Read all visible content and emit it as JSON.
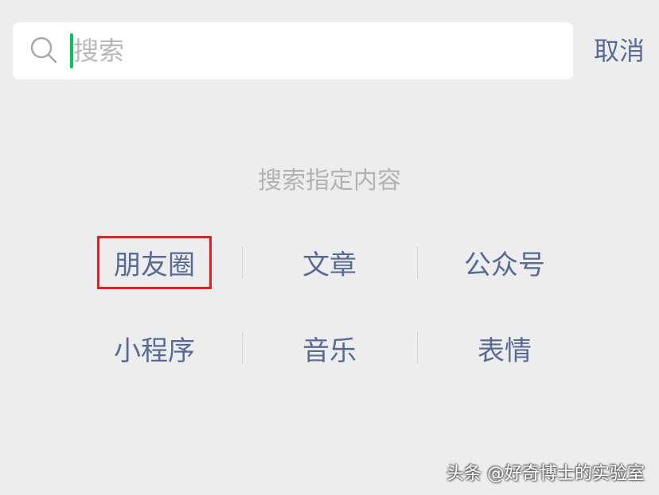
{
  "search": {
    "placeholder": "搜索",
    "value": "",
    "cancel_label": "取消"
  },
  "section_title": "搜索指定内容",
  "categories": {
    "row1": [
      "朋友圈",
      "文章",
      "公众号"
    ],
    "row2": [
      "小程序",
      "音乐",
      "表情"
    ]
  },
  "highlight": "朋友圈",
  "watermark": "头条 @好奇博士的实验室",
  "colors": {
    "background": "#ededed",
    "link": "#576b95",
    "cursor": "#07c160",
    "highlight_box": "#e02020"
  }
}
